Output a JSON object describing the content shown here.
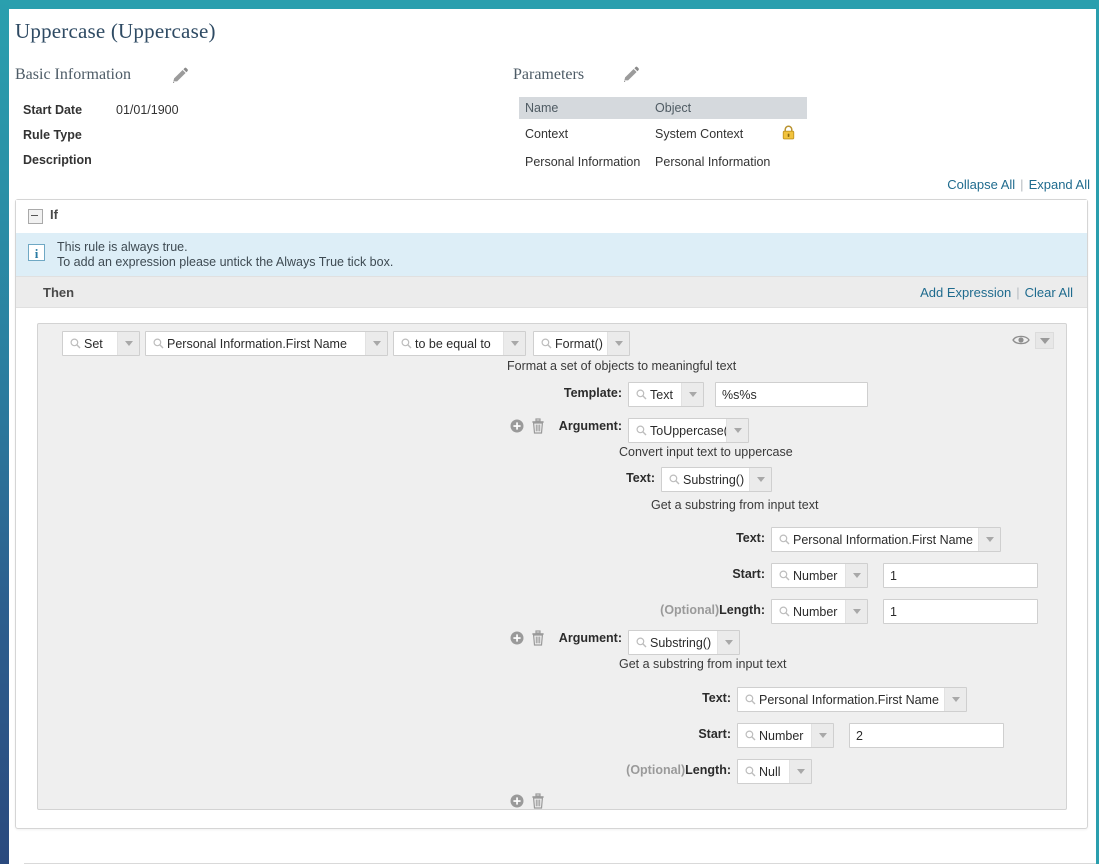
{
  "window": {
    "title": "Uppercase (Uppercase)",
    "accent_top": "#2a9fae",
    "accent_left_top": "#2a9fae",
    "accent_left_bottom": "#2b4a7e"
  },
  "basic_information": {
    "heading": "Basic Information",
    "edit_icon": "pencil-icon",
    "rows": [
      {
        "label": "Start Date",
        "value": "01/01/1900"
      },
      {
        "label": "Rule Type",
        "value": ""
      },
      {
        "label": "Description",
        "value": ""
      }
    ]
  },
  "parameters": {
    "heading": "Parameters",
    "edit_icon": "pencil-icon",
    "columns": [
      "Name",
      "Object",
      ""
    ],
    "rows": [
      {
        "name": "Context",
        "object": "System Context",
        "locked": true,
        "lock_icon": "lock-icon"
      },
      {
        "name": "Personal Information",
        "object": "Personal Information",
        "locked": false,
        "lock_icon": ""
      }
    ]
  },
  "tree_controls": {
    "collapse_all": "Collapse All",
    "expand_all": "Expand All",
    "link_color": "#1f6b8e"
  },
  "rule": {
    "if_section": {
      "label": "If",
      "toggle_icon": "collapse-minus-icon",
      "info_icon": "info-icon",
      "info_line_1": "This rule is always true.",
      "info_line_2": "To add an expression please untick the Always True tick box.",
      "banner_color": "#ddeef7"
    },
    "then_section": {
      "label": "Then",
      "add_expression": "Add Expression",
      "clear_all": "Clear All"
    },
    "expression": {
      "eye_icon": "eye-icon",
      "menu_icon": "chevron-down-icon",
      "action": {
        "value": "Set",
        "search_icon": "magnifier-icon"
      },
      "target": {
        "value": "Personal Information.First Name",
        "search_icon": "magnifier-icon"
      },
      "operator": {
        "value": "to be equal to",
        "search_icon": "magnifier-icon"
      },
      "function": {
        "value": "Format()",
        "search_icon": "magnifier-icon"
      },
      "function_description": "Format a set of objects to meaningful text",
      "template": {
        "label": "Template:",
        "type": "Text",
        "value": "%s%s"
      },
      "arguments": [
        {
          "label": "Argument:",
          "add_icon": "plus-circle-icon",
          "delete_icon": "trash-icon",
          "function": "ToUppercase()",
          "description": "Convert input text to uppercase",
          "fields": [
            {
              "label": "Text:",
              "type": "Substring()",
              "value": null,
              "optional": false
            }
          ],
          "nested": {
            "description": "Get a substring from input text",
            "fields": [
              {
                "label": "Text:",
                "type": "Personal Information.First Name",
                "value": null,
                "optional": false
              },
              {
                "label": "Start:",
                "type": "Number",
                "value": "1",
                "optional": false
              },
              {
                "label": "Length:",
                "optional_tag": "(Optional)",
                "type": "Number",
                "value": "1",
                "optional": true
              }
            ]
          }
        },
        {
          "label": "Argument:",
          "add_icon": "plus-circle-icon",
          "delete_icon": "trash-icon",
          "function": "Substring()",
          "description": "Get a substring from input text",
          "fields": [
            {
              "label": "Text:",
              "type": "Personal Information.First Name",
              "value": null,
              "optional": false
            },
            {
              "label": "Start:",
              "type": "Number",
              "value": "2",
              "optional": false
            },
            {
              "label": "Length:",
              "optional_tag": "(Optional)",
              "type": "Null",
              "value": null,
              "optional": true
            }
          ]
        }
      ],
      "footer": {
        "add_icon": "plus-circle-icon",
        "delete_icon": "trash-icon"
      }
    }
  }
}
